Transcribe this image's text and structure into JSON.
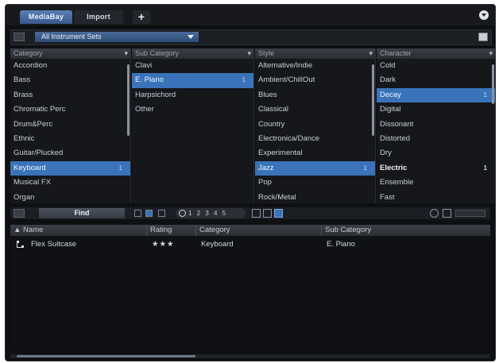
{
  "tabs": [
    {
      "label": "MediaBay"
    },
    {
      "label": "Import"
    },
    {
      "label": "+"
    }
  ],
  "set_selector": {
    "value": "All Instrument Sets"
  },
  "columns": {
    "category": {
      "header": "Category",
      "items": [
        "Accordion",
        "Bass",
        "Brass",
        "Chromatic Perc",
        "Drum&Perc",
        "Ethnic",
        "Guitar/Plucked",
        "Keyboard",
        "Musical FX",
        "Organ"
      ],
      "selected_index": 7,
      "selected_count": "1"
    },
    "subcategory": {
      "header": "Sub Category",
      "items": [
        "Clavi",
        "E. Piano",
        "Harpsichord",
        "Other"
      ],
      "selected_index": 1,
      "selected_count": "1"
    },
    "style": {
      "header": "Style",
      "items": [
        "Alternative/Indie",
        "Ambient/ChillOut",
        "Blues",
        "Classical",
        "Country",
        "Electronica/Dance",
        "Experimental",
        "Jazz",
        "Pop",
        "Rock/Metal"
      ],
      "selected_index": 7,
      "selected_count": "1"
    },
    "character": {
      "header": "Character",
      "items": [
        "Cold",
        "Dark",
        "Decay",
        "Digital",
        "Dissonant",
        "Distorted",
        "Dry",
        "Electric",
        "Ensemble",
        "Fast"
      ],
      "selected_index": 2,
      "selected_count": "1",
      "bold_index": 7,
      "bold_count": "1"
    }
  },
  "toolbar": {
    "find_label": "Find",
    "rating_values": "1 2 3 4 5"
  },
  "results": {
    "headers": {
      "name": "Name",
      "rating": "Rating",
      "category": "Category",
      "subcategory": "Sub Category"
    },
    "rows": [
      {
        "name": "Flex Suitcase",
        "rating": "★★★",
        "category": "Keyboard",
        "subcategory": "E. Piano"
      }
    ]
  },
  "colors": {
    "accent": "#3a73b9",
    "background": "#0e0f12"
  }
}
